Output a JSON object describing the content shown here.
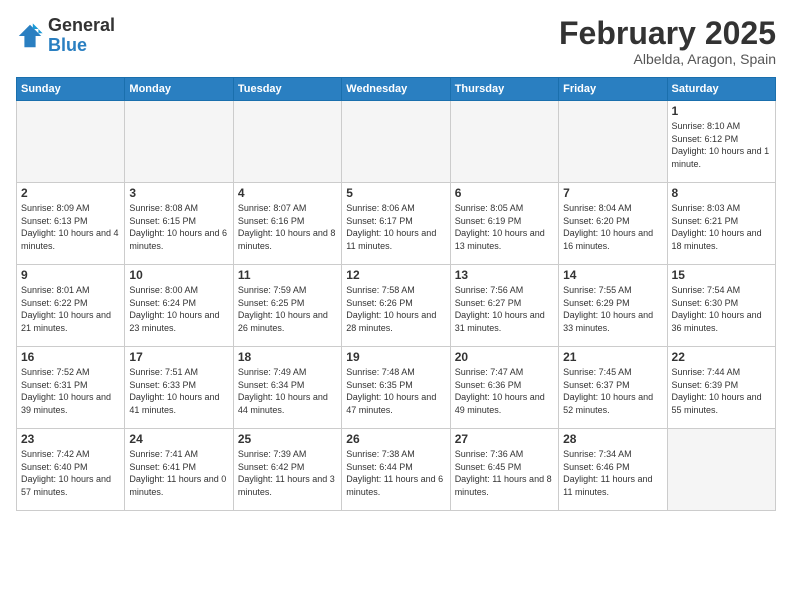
{
  "logo": {
    "general": "General",
    "blue": "Blue"
  },
  "title": "February 2025",
  "location": "Albelda, Aragon, Spain",
  "weekdays": [
    "Sunday",
    "Monday",
    "Tuesday",
    "Wednesday",
    "Thursday",
    "Friday",
    "Saturday"
  ],
  "weeks": [
    [
      {
        "day": "",
        "info": ""
      },
      {
        "day": "",
        "info": ""
      },
      {
        "day": "",
        "info": ""
      },
      {
        "day": "",
        "info": ""
      },
      {
        "day": "",
        "info": ""
      },
      {
        "day": "",
        "info": ""
      },
      {
        "day": "1",
        "info": "Sunrise: 8:10 AM\nSunset: 6:12 PM\nDaylight: 10 hours\nand 1 minute."
      }
    ],
    [
      {
        "day": "2",
        "info": "Sunrise: 8:09 AM\nSunset: 6:13 PM\nDaylight: 10 hours\nand 4 minutes."
      },
      {
        "day": "3",
        "info": "Sunrise: 8:08 AM\nSunset: 6:15 PM\nDaylight: 10 hours\nand 6 minutes."
      },
      {
        "day": "4",
        "info": "Sunrise: 8:07 AM\nSunset: 6:16 PM\nDaylight: 10 hours\nand 8 minutes."
      },
      {
        "day": "5",
        "info": "Sunrise: 8:06 AM\nSunset: 6:17 PM\nDaylight: 10 hours\nand 11 minutes."
      },
      {
        "day": "6",
        "info": "Sunrise: 8:05 AM\nSunset: 6:19 PM\nDaylight: 10 hours\nand 13 minutes."
      },
      {
        "day": "7",
        "info": "Sunrise: 8:04 AM\nSunset: 6:20 PM\nDaylight: 10 hours\nand 16 minutes."
      },
      {
        "day": "8",
        "info": "Sunrise: 8:03 AM\nSunset: 6:21 PM\nDaylight: 10 hours\nand 18 minutes."
      }
    ],
    [
      {
        "day": "9",
        "info": "Sunrise: 8:01 AM\nSunset: 6:22 PM\nDaylight: 10 hours\nand 21 minutes."
      },
      {
        "day": "10",
        "info": "Sunrise: 8:00 AM\nSunset: 6:24 PM\nDaylight: 10 hours\nand 23 minutes."
      },
      {
        "day": "11",
        "info": "Sunrise: 7:59 AM\nSunset: 6:25 PM\nDaylight: 10 hours\nand 26 minutes."
      },
      {
        "day": "12",
        "info": "Sunrise: 7:58 AM\nSunset: 6:26 PM\nDaylight: 10 hours\nand 28 minutes."
      },
      {
        "day": "13",
        "info": "Sunrise: 7:56 AM\nSunset: 6:27 PM\nDaylight: 10 hours\nand 31 minutes."
      },
      {
        "day": "14",
        "info": "Sunrise: 7:55 AM\nSunset: 6:29 PM\nDaylight: 10 hours\nand 33 minutes."
      },
      {
        "day": "15",
        "info": "Sunrise: 7:54 AM\nSunset: 6:30 PM\nDaylight: 10 hours\nand 36 minutes."
      }
    ],
    [
      {
        "day": "16",
        "info": "Sunrise: 7:52 AM\nSunset: 6:31 PM\nDaylight: 10 hours\nand 39 minutes."
      },
      {
        "day": "17",
        "info": "Sunrise: 7:51 AM\nSunset: 6:33 PM\nDaylight: 10 hours\nand 41 minutes."
      },
      {
        "day": "18",
        "info": "Sunrise: 7:49 AM\nSunset: 6:34 PM\nDaylight: 10 hours\nand 44 minutes."
      },
      {
        "day": "19",
        "info": "Sunrise: 7:48 AM\nSunset: 6:35 PM\nDaylight: 10 hours\nand 47 minutes."
      },
      {
        "day": "20",
        "info": "Sunrise: 7:47 AM\nSunset: 6:36 PM\nDaylight: 10 hours\nand 49 minutes."
      },
      {
        "day": "21",
        "info": "Sunrise: 7:45 AM\nSunset: 6:37 PM\nDaylight: 10 hours\nand 52 minutes."
      },
      {
        "day": "22",
        "info": "Sunrise: 7:44 AM\nSunset: 6:39 PM\nDaylight: 10 hours\nand 55 minutes."
      }
    ],
    [
      {
        "day": "23",
        "info": "Sunrise: 7:42 AM\nSunset: 6:40 PM\nDaylight: 10 hours\nand 57 minutes."
      },
      {
        "day": "24",
        "info": "Sunrise: 7:41 AM\nSunset: 6:41 PM\nDaylight: 11 hours\nand 0 minutes."
      },
      {
        "day": "25",
        "info": "Sunrise: 7:39 AM\nSunset: 6:42 PM\nDaylight: 11 hours\nand 3 minutes."
      },
      {
        "day": "26",
        "info": "Sunrise: 7:38 AM\nSunset: 6:44 PM\nDaylight: 11 hours\nand 6 minutes."
      },
      {
        "day": "27",
        "info": "Sunrise: 7:36 AM\nSunset: 6:45 PM\nDaylight: 11 hours\nand 8 minutes."
      },
      {
        "day": "28",
        "info": "Sunrise: 7:34 AM\nSunset: 6:46 PM\nDaylight: 11 hours\nand 11 minutes."
      },
      {
        "day": "",
        "info": ""
      }
    ]
  ]
}
